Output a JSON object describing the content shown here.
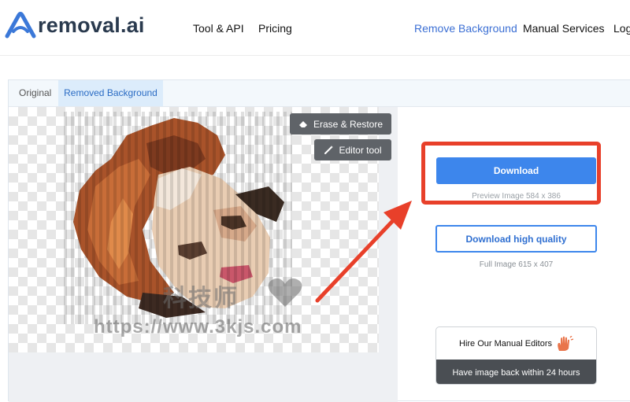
{
  "brand": {
    "name": "removal.ai",
    "accent": "#3b6fd4"
  },
  "nav": {
    "tool_api": "Tool & API",
    "pricing": "Pricing",
    "remove_background": "Remove Background",
    "manual_services": "Manual Services",
    "login": "Log"
  },
  "tabs": {
    "original": "Original",
    "removed": "Removed Background"
  },
  "tools": {
    "erase_restore": "Erase & Restore",
    "editor_tool": "Editor tool"
  },
  "watermark": {
    "cn": "科技师",
    "url": "https://www.3kjs.com"
  },
  "download": {
    "button": "Download",
    "preview_info": "Preview Image   584 x 386",
    "hq_button": "Download high quality",
    "full_info": "Full Image   615 x 407"
  },
  "manual": {
    "title": "Hire Our Manual Editors",
    "subtitle": "Have image back within 24 hours"
  },
  "colors": {
    "download_blue": "#3d86ec",
    "highlight_red": "#e8402a",
    "tool_gray": "#5f6368"
  },
  "icons": [
    "removal-ai-logo-icon",
    "eraser-icon",
    "magic-wand-icon",
    "hand-wave-icon",
    "heart-icon",
    "arrow-icon"
  ]
}
